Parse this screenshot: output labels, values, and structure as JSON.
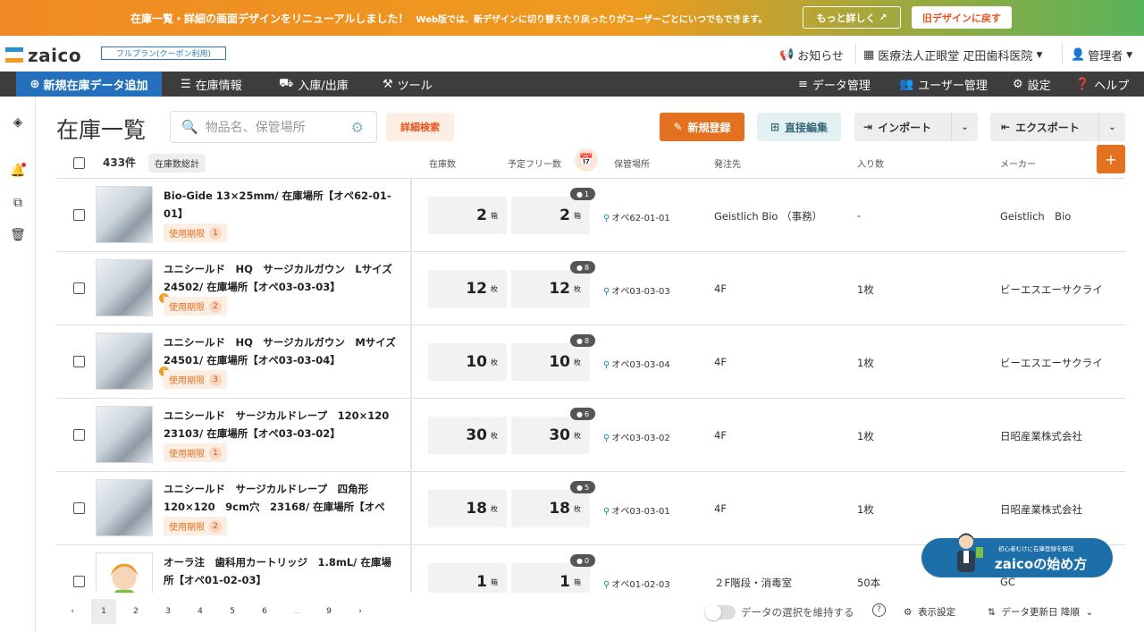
{
  "banner": {
    "message": "在庫一覧・詳細の画面デザインをリニューアルしました！",
    "sub_message": "Web版では、新デザインに切り替えたり戻ったりがユーザーごとにいつでもできます。",
    "more_label": "もっと詳しく",
    "old_design_label": "旧デザインに戻す"
  },
  "header": {
    "logo": "zaico",
    "plan": "フルプラン(クーポン利用)",
    "notice": "お知らせ",
    "org": "医療法人正眼堂 疋田歯科医院",
    "user": "管理者"
  },
  "nav": {
    "add_label": "新規在庫データ追加",
    "items": [
      "在庫情報",
      "入庫/出庫",
      "ツール"
    ],
    "right_items": [
      "データ管理",
      "ユーザー管理",
      "設定",
      "ヘルプ"
    ]
  },
  "page": {
    "title": "在庫一覧",
    "search_placeholder": "物品名、保管場所",
    "advanced_search": "詳細検索",
    "new_button": "新規登録",
    "direct_edit": "直接編集",
    "import": "インポート",
    "export": "エクスポート"
  },
  "table": {
    "count": "433件",
    "stock_total": "在庫数総計",
    "headers": [
      "在庫数",
      "予定フリー数",
      "保管場所",
      "発注先",
      "入り数",
      "メーカー"
    ],
    "expiry_label": "使用期限",
    "rows": [
      {
        "name": "Bio-Gide 13×25mm/ 在庫場所【オペ62-01-01】",
        "expiry": "1",
        "warn": false,
        "qty": "2",
        "unit": "箱",
        "free": "2",
        "free_unit": "箱",
        "badge": "1",
        "location": "オペ62-01-01",
        "supplier": "Geistlich Bio （事務）",
        "per": "-",
        "maker": "Geistlich　Bio"
      },
      {
        "name": "ユニシールド　HQ　サージカルガウン　Lサイズ　24502/ 在庫場所【オペ03-03-03】",
        "expiry": "2",
        "warn": true,
        "qty": "12",
        "unit": "枚",
        "free": "12",
        "free_unit": "枚",
        "badge": "8",
        "location": "オペ03-03-03",
        "supplier": "4F",
        "per": "1枚",
        "maker": "ビーエスエーサクライ"
      },
      {
        "name": "ユニシールド　HQ　サージカルガウン　Mサイズ　24501/ 在庫場所【オペ03-03-04】",
        "expiry": "3",
        "warn": true,
        "qty": "10",
        "unit": "枚",
        "free": "10",
        "free_unit": "枚",
        "badge": "8",
        "location": "オペ03-03-04",
        "supplier": "4F",
        "per": "1枚",
        "maker": "ビーエスエーサクライ"
      },
      {
        "name": "ユニシールド　サージカルドレープ　120×120　23103/ 在庫場所【オペ03-03-02】",
        "expiry": "1",
        "warn": false,
        "qty": "30",
        "unit": "枚",
        "free": "30",
        "free_unit": "枚",
        "badge": "6",
        "location": "オペ03-03-02",
        "supplier": "4F",
        "per": "1枚",
        "maker": "日昭産業株式会社"
      },
      {
        "name": "ユニシールド　サージカルドレープ　四角形　120×120　9cm穴　23168/ 在庫場所【オペ0...",
        "expiry": "2",
        "warn": false,
        "qty": "18",
        "unit": "枚",
        "free": "18",
        "free_unit": "枚",
        "badge": "5",
        "location": "オペ03-03-01",
        "supplier": "4F",
        "per": "1枚",
        "maker": "日昭産業株式会社"
      },
      {
        "name": "オーラ注　歯科用カートリッジ　1.8mL/ 在庫場所【オペ01-02-03】",
        "expiry": "",
        "warn": false,
        "qty": "1",
        "unit": "箱",
        "free": "1",
        "free_unit": "箱",
        "badge": "0",
        "location": "オペ01-02-03",
        "supplier": "２F階段・消毒室",
        "per": "50本",
        "maker": "GC"
      }
    ]
  },
  "pagination": [
    "1",
    "2",
    "3",
    "4",
    "5",
    "6",
    "...",
    "9"
  ],
  "footer": {
    "keep_selection": "データの選択を維持する",
    "display_settings": "表示設定",
    "sort": "データ更新日 降順"
  },
  "promo": {
    "sub": "初心者むけに在庫登録を解説",
    "main": "zaicoの始め方"
  },
  "colors": {
    "accent": "#e37120",
    "primary": "#2470bd",
    "nav_bg": "#3d3d3d"
  }
}
